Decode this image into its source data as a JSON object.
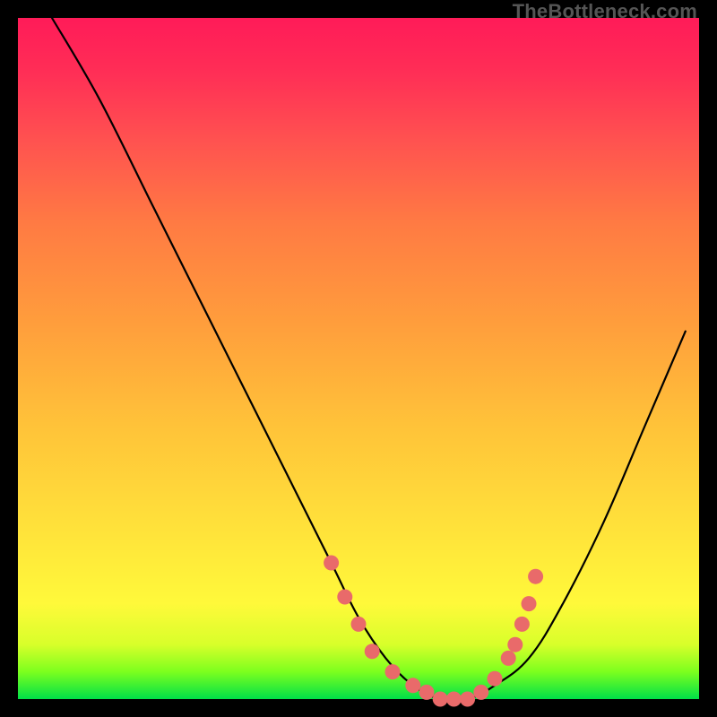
{
  "watermark": "TheBottleneck.com",
  "chart_data": {
    "type": "line",
    "title": "",
    "xlabel": "",
    "ylabel": "",
    "x_range": [
      0,
      100
    ],
    "y_range": [
      0,
      100
    ],
    "series": [
      {
        "name": "bottleneck-curve",
        "x": [
          5,
          12,
          20,
          28,
          35,
          41,
          46,
          50,
          54,
          58,
          62,
          66,
          70,
          75,
          80,
          86,
          92,
          98
        ],
        "y": [
          100,
          88,
          72,
          56,
          42,
          30,
          20,
          12,
          6,
          2,
          0,
          0,
          2,
          6,
          14,
          26,
          40,
          54
        ]
      }
    ],
    "markers": {
      "name": "highlighted-region",
      "x": [
        46,
        48,
        50,
        52,
        55,
        58,
        60,
        62,
        64,
        66,
        68,
        70,
        72,
        73,
        74,
        75,
        76
      ],
      "y": [
        20,
        15,
        11,
        7,
        4,
        2,
        1,
        0,
        0,
        0,
        1,
        3,
        6,
        8,
        11,
        14,
        18
      ]
    },
    "gradient_stops": [
      {
        "pos": 0,
        "color": "#00e048"
      },
      {
        "pos": 8,
        "color": "#d8ff2a"
      },
      {
        "pos": 25,
        "color": "#ffe23a"
      },
      {
        "pos": 55,
        "color": "#ff9e3c"
      },
      {
        "pos": 82,
        "color": "#ff5250"
      },
      {
        "pos": 100,
        "color": "#ff1b58"
      }
    ]
  }
}
